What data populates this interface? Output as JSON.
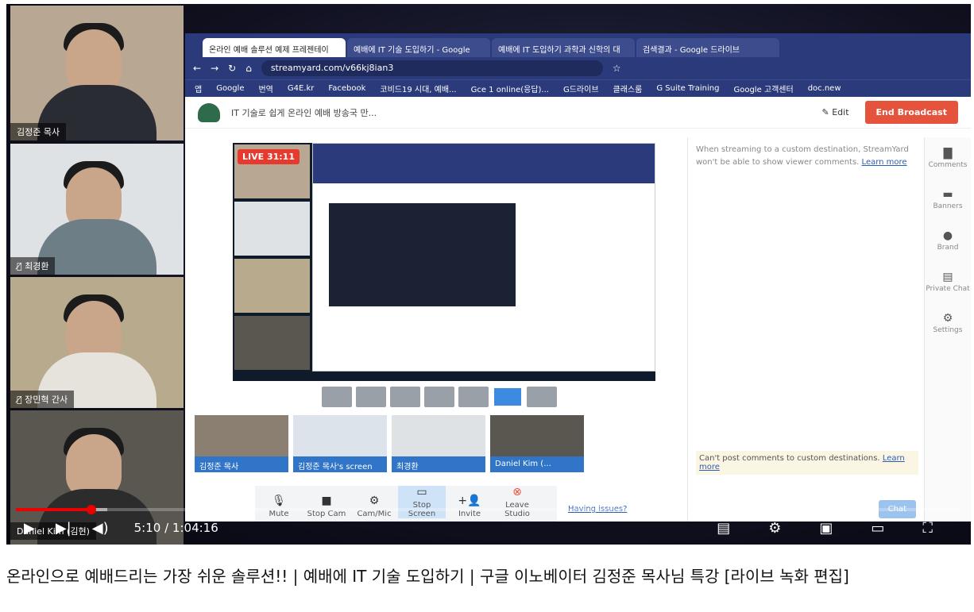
{
  "tiles": [
    {
      "name": "김정준 목사",
      "shirt": "#2a2c34"
    },
    {
      "name": "최경환",
      "shirt": "#6e7e86"
    },
    {
      "name": "장민혁 간사",
      "shirt": "#e6e3dc"
    },
    {
      "name": "Daniel Kim (김현)",
      "shirt": "#2c2c2c"
    }
  ],
  "browser": {
    "tabs": [
      "온라인 예배 솔루션 예제 프레젠테이",
      "예배에 IT 기술 도입하기 - Google",
      "예배에 IT 도입하기 과학과 신학의 대",
      "검색결과 - Google 드라이브"
    ],
    "url": "streamyard.com/v66kj8ian3",
    "bookmarks": [
      "앱",
      "Google",
      "번역",
      "G4E.kr",
      "Facebook",
      "코비드19 시대, 예배...",
      "Gce 1 online(응답)...",
      "G드라이브",
      "클래스룸",
      "G Suite Training",
      "Google 고객센터",
      "doc.new"
    ]
  },
  "streamyard": {
    "broadcast_title": "IT 기술로 쉽게 온라인 예배 방송국 만...",
    "edit_label": "Edit",
    "end_label": "End Broadcast",
    "live_label": "LIVE 31:11",
    "guests": [
      "김정준 목사",
      "김정준 목사's screen",
      "최경환",
      "Daniel Kim (..."
    ],
    "toolbar": [
      "Mute",
      "Stop Cam",
      "Cam/Mic",
      "Stop Screen",
      "Invite",
      "Leave Studio"
    ],
    "issues_link": "Having issues?",
    "comments_msg": "When streaming to a custom destination, StreamYard won't be able to show viewer comments.",
    "learn_more": "Learn more",
    "cant_post": "Can't post comments to custom destinations.",
    "chat_label": "Chat",
    "sidebar": [
      "Comments",
      "Banners",
      "Brand",
      "Private Chat",
      "Settings"
    ]
  },
  "player": {
    "current_time": "5:10",
    "duration": "1:04:16",
    "progress": 0.08
  },
  "video_title": "온라인으로 예배드리는 가장 쉬운 솔루션!! | 예배에 IT 기술 도입하기 | 구글 이노베이터 김정준 목사님 특강 [라이브 녹화 편집]"
}
